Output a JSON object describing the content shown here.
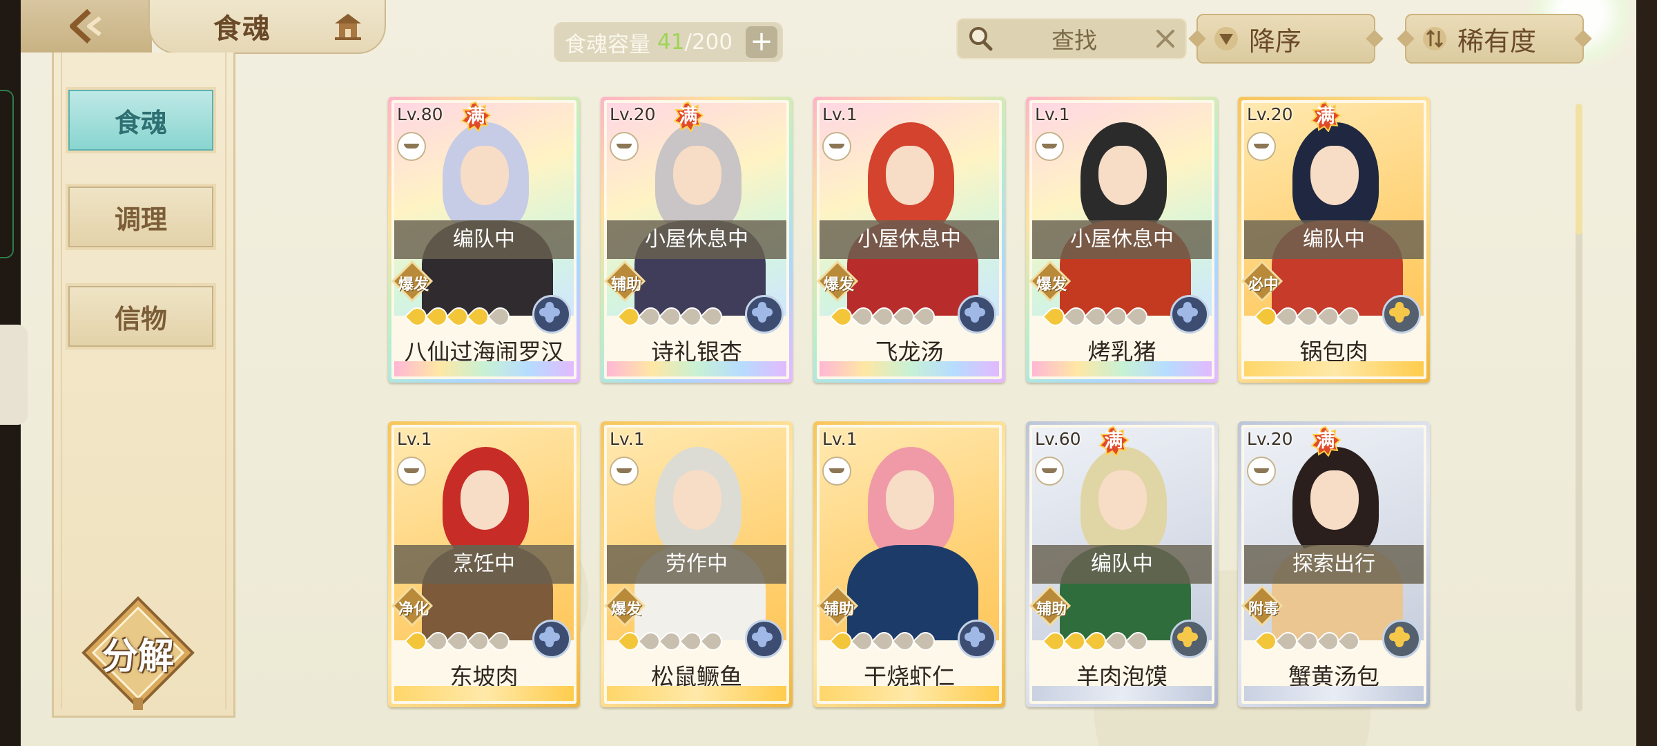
{
  "header": {
    "title": "食魂",
    "capacity_label": "食魂容量",
    "capacity_used": "41",
    "capacity_total": "/200",
    "capacity_plus": "+",
    "search_placeholder": "查找",
    "sort_order_label": "降序",
    "sort_by_label": "稀有度"
  },
  "sidebar": {
    "items": [
      {
        "label": "食魂",
        "active": true
      },
      {
        "label": "调理",
        "active": false
      },
      {
        "label": "信物",
        "active": false
      }
    ],
    "decompose_label": "分解"
  },
  "cards": [
    {
      "level": "Lv.80",
      "full": "满",
      "status": "编队中",
      "role": "爆发",
      "stars": 4,
      "name": "八仙过海闹罗汉",
      "rarity": "rainbow",
      "emblem": "blue",
      "hair": "#c6cbe6",
      "outfit": "#2f2b2f"
    },
    {
      "level": "Lv.20",
      "full": "满",
      "status": "小屋休息中",
      "role": "辅助",
      "stars": 1,
      "name": "诗礼银杏",
      "rarity": "rainbow",
      "emblem": "blue",
      "hair": "#c9c4c6",
      "outfit": "#3f3d5a"
    },
    {
      "level": "Lv.1",
      "full": "",
      "status": "小屋休息中",
      "role": "爆发",
      "stars": 1,
      "name": "飞龙汤",
      "rarity": "rainbow",
      "emblem": "blue",
      "hair": "#d3432e",
      "outfit": "#b92c2c"
    },
    {
      "level": "Lv.1",
      "full": "",
      "status": "小屋休息中",
      "role": "爆发",
      "stars": 1,
      "name": "烤乳猪",
      "rarity": "rainbow",
      "emblem": "blue",
      "hair": "#2b2b2b",
      "outfit": "#c43a20"
    },
    {
      "level": "Lv.20",
      "full": "满",
      "status": "编队中",
      "role": "必中",
      "stars": 1,
      "name": "锅包肉",
      "rarity": "gold",
      "emblem": "gold",
      "hair": "#1f2840",
      "outfit": "#c63b2a"
    },
    {
      "level": "Lv.1",
      "full": "",
      "status": "烹饪中",
      "role": "净化",
      "stars": 1,
      "name": "东坡肉",
      "rarity": "gold",
      "emblem": "blue",
      "hair": "#c82c27",
      "outfit": "#7c5a3a"
    },
    {
      "level": "Lv.1",
      "full": "",
      "status": "劳作中",
      "role": "爆发",
      "stars": 1,
      "name": "松鼠鳜鱼",
      "rarity": "gold",
      "emblem": "blue",
      "hair": "#dcdcd4",
      "outfit": "#f2f0ea"
    },
    {
      "level": "Lv.1",
      "full": "",
      "status": "",
      "role": "辅助",
      "stars": 1,
      "name": "干烧虾仁",
      "rarity": "gold",
      "emblem": "blue",
      "hair": "#f09aa8",
      "outfit": "#1c3b69"
    },
    {
      "level": "Lv.60",
      "full": "满",
      "status": "编队中",
      "role": "辅助",
      "stars": 3,
      "name": "羊肉泡馍",
      "rarity": "silver",
      "emblem": "gold",
      "hair": "#e0d5a4",
      "outfit": "#2f6e3c"
    },
    {
      "level": "Lv.20",
      "full": "满",
      "status": "探索出行",
      "role": "附毒",
      "stars": 1,
      "name": "蟹黄汤包",
      "rarity": "silver",
      "emblem": "gold",
      "hair": "#2a1f1c",
      "outfit": "#ecc690"
    }
  ]
}
